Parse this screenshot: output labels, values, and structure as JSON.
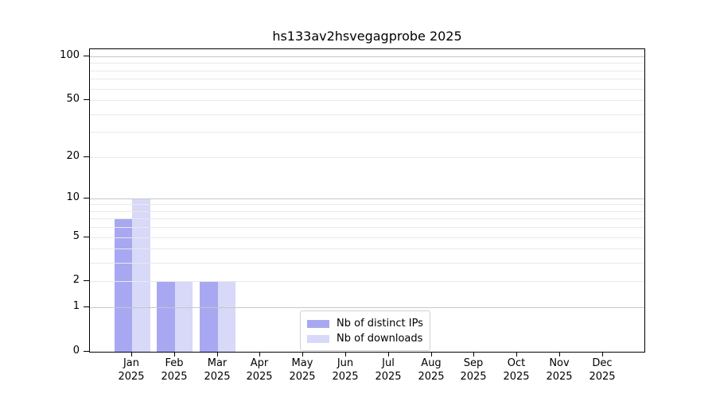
{
  "title": "hs133av2hsvegagprobe 2025",
  "chart_data": {
    "type": "bar",
    "title": "hs133av2hsvegagprobe 2025",
    "categories": [
      "Jan",
      "Feb",
      "Mar",
      "Apr",
      "May",
      "Jun",
      "Jul",
      "Aug",
      "Sep",
      "Oct",
      "Nov",
      "Dec"
    ],
    "year_label": "2025",
    "series": [
      {
        "name": "Nb of distinct IPs",
        "color": "#a8a8f2",
        "values": [
          7,
          2,
          2,
          0,
          0,
          0,
          0,
          0,
          0,
          0,
          0,
          0
        ]
      },
      {
        "name": "Nb of downloads",
        "color": "#d8d8f8",
        "values": [
          10,
          2,
          2,
          0,
          0,
          0,
          0,
          0,
          0,
          0,
          0,
          0
        ]
      }
    ],
    "yscale": "log1p",
    "yticks": [
      0,
      1,
      2,
      5,
      10,
      20,
      50,
      100
    ],
    "minor_gridlines": [
      3,
      4,
      6,
      7,
      8,
      9,
      30,
      40,
      60,
      70,
      80,
      90
    ],
    "ylim": [
      0,
      112
    ],
    "grid": true,
    "legend_position": "lower center",
    "colors": {
      "decade_gridline": "#c6c6c6",
      "minor_gridline": "#e9e9e9",
      "spine": "#000000",
      "legend_border": "#d0d0d0"
    }
  }
}
